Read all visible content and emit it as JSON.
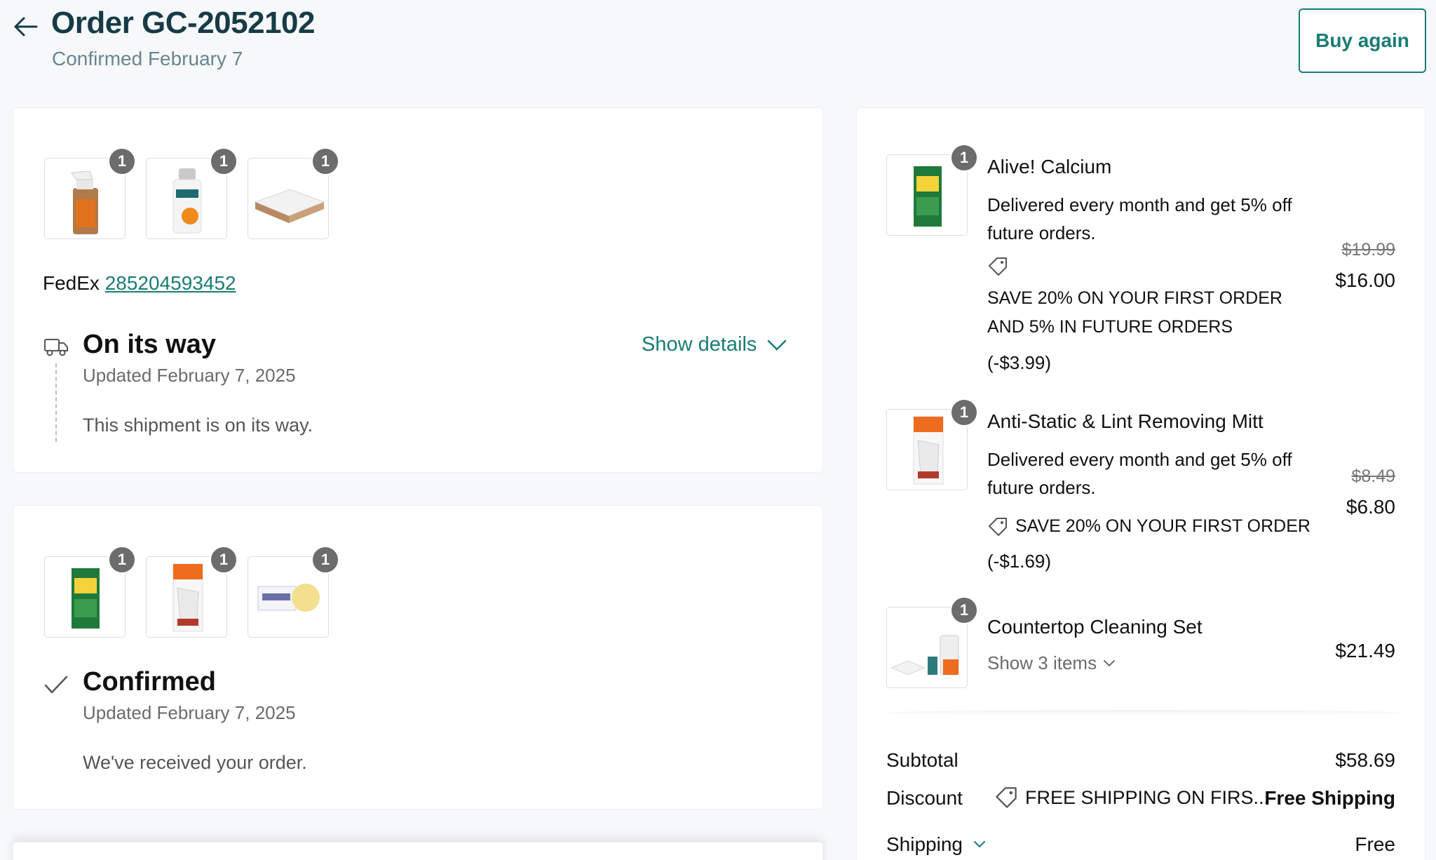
{
  "header": {
    "title": "Order GC-2052102",
    "subtitle": "Confirmed February 7",
    "buy_again": "Buy again"
  },
  "shipment": {
    "items": [
      {
        "icon": "spray-bottle-icon",
        "qty": "1"
      },
      {
        "icon": "dropper-bottle-icon",
        "qty": "1"
      },
      {
        "icon": "sponge-icon",
        "qty": "1"
      }
    ],
    "carrier": "FedEx",
    "tracking": "285204593452",
    "status": "On its way",
    "updated": "Updated February 7, 2025",
    "message": "This shipment is on its way.",
    "show_details": "Show details"
  },
  "confirmed": {
    "items": [
      {
        "icon": "supplement-box-icon",
        "qty": "1"
      },
      {
        "icon": "lint-mitt-icon",
        "qty": "1"
      },
      {
        "icon": "soap-bar-icon",
        "qty": "1"
      }
    ],
    "status": "Confirmed",
    "updated": "Updated February 7, 2025",
    "message": "We've received your order."
  },
  "order_items": [
    {
      "name": "Alive! Calcium",
      "desc": "Delivered every month and get 5% off future orders.",
      "promo": "SAVE 20% ON YOUR FIRST ORDER AND 5% IN FUTURE ORDERS",
      "discount": "(-$3.99)",
      "old_price": "$19.99",
      "price": "$16.00",
      "qty": "1"
    },
    {
      "name": "Anti-Static & Lint Removing Mitt",
      "desc": "Delivered every month and get 5% off future orders.",
      "promo": "SAVE 20% ON YOUR FIRST ORDER",
      "discount": "(-$1.69)",
      "old_price": "$8.49",
      "price": "$6.80",
      "qty": "1"
    },
    {
      "name": "Countertop Cleaning Set",
      "show_items": "Show 3 items",
      "price": "$21.49",
      "qty": "1"
    }
  ],
  "summary": {
    "subtotal_label": "Subtotal",
    "subtotal": "$58.69",
    "discount_label": "Discount",
    "discount_code": "FREE SHIPPING ON FIRS...",
    "discount_value": "Free Shipping",
    "shipping_label": "Shipping",
    "shipping_value": "Free"
  },
  "colors": {
    "accent": "#1a7c74",
    "title": "#163b45",
    "badge": "#6c6c6c"
  }
}
